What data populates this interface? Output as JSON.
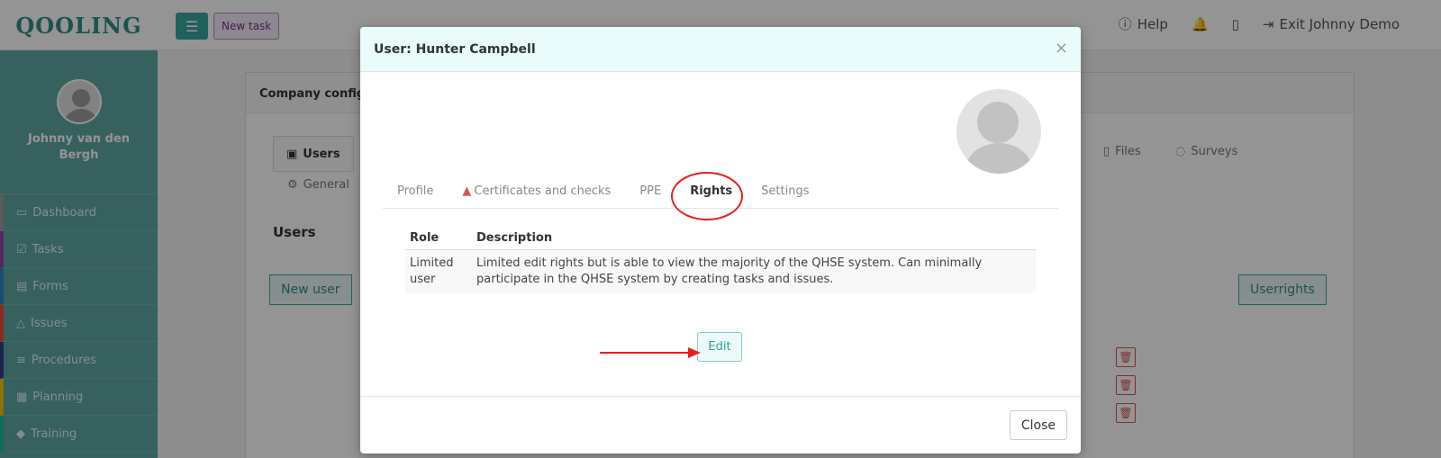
{
  "app": {
    "logo_text": "QOOLING",
    "new_task_label": "New task",
    "help_label": "Help",
    "exit_label": "Exit Johnny Demo"
  },
  "sidebar": {
    "user_name": "Johnny van den Bergh",
    "items": [
      {
        "label": "Dashboard",
        "color": "#9e9e9e"
      },
      {
        "label": "Tasks",
        "color": "#8e44ad"
      },
      {
        "label": "Forms",
        "color": "#2e86c1"
      },
      {
        "label": "Issues",
        "color": "#e74c3c"
      },
      {
        "label": "Procedures",
        "color": "#2c3e90"
      },
      {
        "label": "Planning",
        "color": "#f1c40f"
      },
      {
        "label": "Training",
        "color": "#1abc9c"
      }
    ]
  },
  "background_page": {
    "card_title": "Company config",
    "tab_users": "Users",
    "tab_general": "General",
    "tab_files": "Files",
    "tab_surveys": "Surveys",
    "heading": "Users",
    "new_user_label": "New user",
    "userrights_label": "Userrights"
  },
  "modal": {
    "title": "User: Hunter Campbell",
    "tabs": [
      "Profile",
      "Certificates and checks",
      "PPE",
      "Rights",
      "Settings"
    ],
    "active_tab": "Rights",
    "table": {
      "headers": [
        "Role",
        "Description"
      ],
      "rows": [
        {
          "role": "Limited user",
          "description": "Limited edit rights but is able to view the majority of the QHSE system. Can minimally participate in the QHSE system by creating tasks and issues."
        }
      ]
    },
    "edit_label": "Edit",
    "close_label": "Close"
  },
  "colors": {
    "accent": "#3aa79f",
    "annotation": "#e3201f"
  }
}
